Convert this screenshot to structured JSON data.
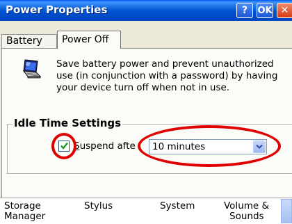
{
  "window": {
    "title": "Power Properties",
    "help_label": "?",
    "ok_label": "OK",
    "close_label": "✕"
  },
  "tabs": [
    {
      "label": "Battery",
      "selected": false
    },
    {
      "label": "Power Off",
      "selected": true
    }
  ],
  "power_off": {
    "icon": "laptop-icon",
    "description_lines": [
      "Save battery power and prevent unauthorized",
      "use (in conjunction with a password) by having",
      "your device turn off when not in use."
    ],
    "group_title": "Idle Time Settings",
    "suspend_checkbox": {
      "checked": true,
      "label_first": "S",
      "label_rest": "uspend afte"
    },
    "suspend_select": {
      "value": "10 minutes",
      "icon": "chevron-down-icon"
    }
  },
  "control_panel_items": [
    {
      "line1": "Storage",
      "line2": "Manager"
    },
    {
      "line1": "Stylus",
      "line2": ""
    },
    {
      "line1": "System",
      "line2": ""
    },
    {
      "line1": "Volume &",
      "line2": "Sounds"
    }
  ],
  "colors": {
    "titlebar": "#0a5fd8",
    "annotation_circle": "#e00000",
    "checkmark": "#1a9a1a"
  }
}
